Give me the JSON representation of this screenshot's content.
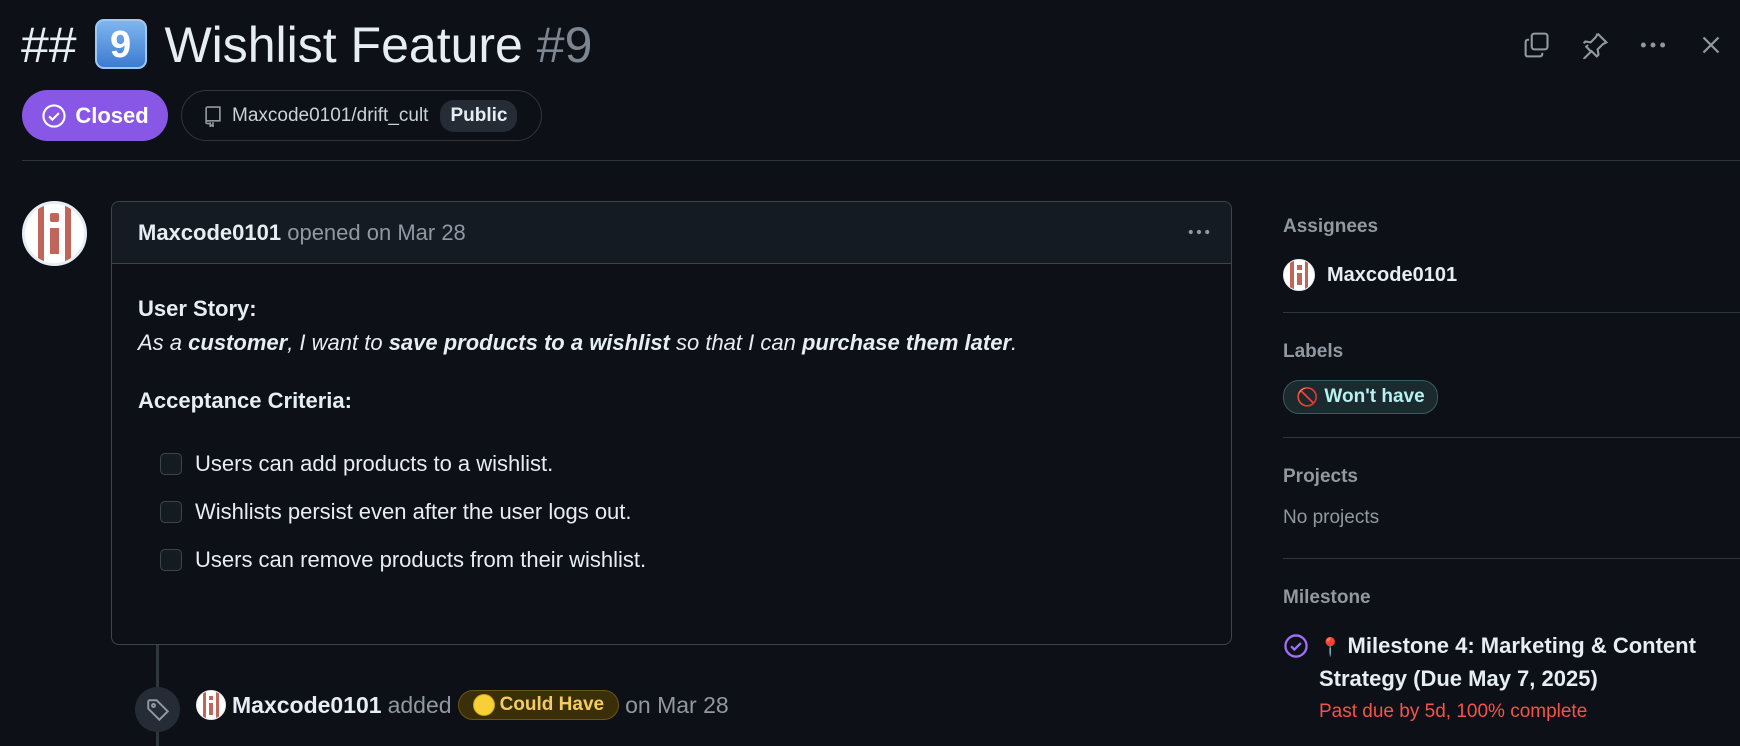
{
  "header": {
    "title_prefix": "##",
    "title_keycap": "9",
    "title_text": "Wishlist Feature",
    "issue_number": "#9",
    "status": "Closed",
    "repo": "Maxcode0101/drift_cult",
    "visibility": "Public"
  },
  "comment": {
    "author": "Maxcode0101",
    "opened_text": "opened on Mar 28",
    "story_label": "User Story:",
    "story_parts": {
      "a": "As a ",
      "b": "customer",
      "c": ", I want to ",
      "d": "save products to a wishlist",
      "e": " so that I can ",
      "f": "purchase them later",
      "g": "."
    },
    "criteria_label": "Acceptance Criteria:",
    "tasks": [
      "Users can add products to a wishlist.",
      "Wishlists persist even after the user logs out.",
      "Users can remove products from their wishlist."
    ]
  },
  "timeline_event": {
    "author": "Maxcode0101",
    "action": "added",
    "label": "Could Have",
    "date": "on Mar 28"
  },
  "sidebar": {
    "assignees_heading": "Assignees",
    "assignee": "Maxcode0101",
    "labels_heading": "Labels",
    "label": "Won't have",
    "projects_heading": "Projects",
    "projects_empty": "No projects",
    "milestone_heading": "Milestone",
    "milestone_title": "Milestone 4: Marketing & Content Strategy (Due May 7, 2025)",
    "milestone_status": "Past due by 5d, 100% complete"
  },
  "colors": {
    "background": "#0d1117",
    "closed_badge": "#8957e5",
    "overdue": "#f85149",
    "avatar_stripe": "#c0655a"
  }
}
